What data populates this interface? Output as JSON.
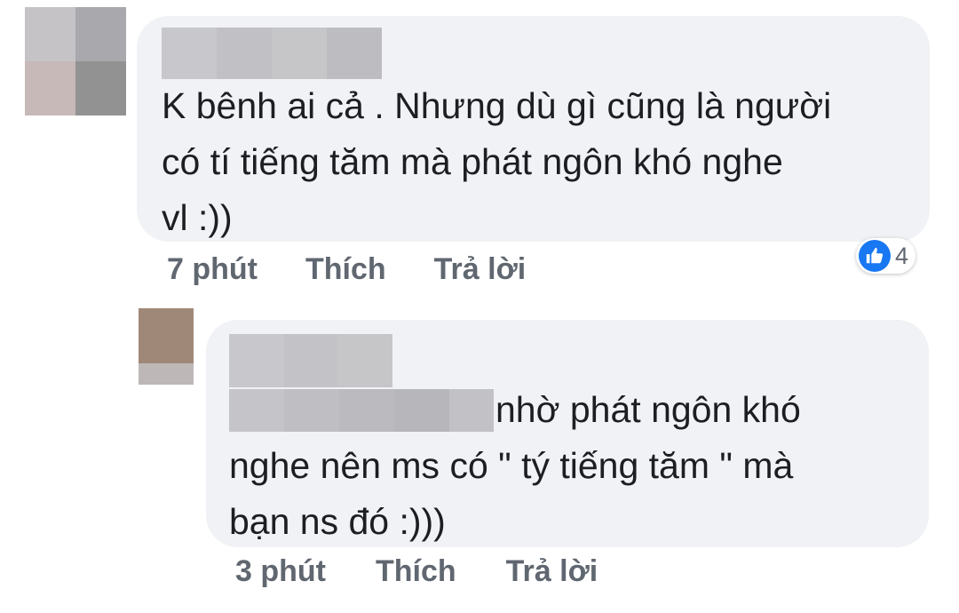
{
  "comments": [
    {
      "lines": [
        "K bênh ai cả  . Nhưng dù gì cũng là người",
        "có tí tiếng tăm mà phát ngôn khó nghe",
        "vl :))"
      ],
      "time": "7 phút",
      "like_label": "Thích",
      "reply_label": "Trả lời",
      "reaction_count": "4",
      "reaction_icon": "like-icon",
      "author_name_blurred": true
    },
    {
      "lines": [
        "nhờ phát ngôn khó",
        "nghe nên ms có \" tý tiếng tăm \" mà",
        "bạn ns đó :)))"
      ],
      "time": "3 phút",
      "like_label": "Thích",
      "reply_label": "Trả lời",
      "author_name_blurred": true,
      "mention_blurred": true
    }
  ],
  "colors": {
    "bubble": "#f0f2f5",
    "text": "#1c1e21",
    "action_text": "#606770",
    "like_blue": "#1877f2"
  }
}
